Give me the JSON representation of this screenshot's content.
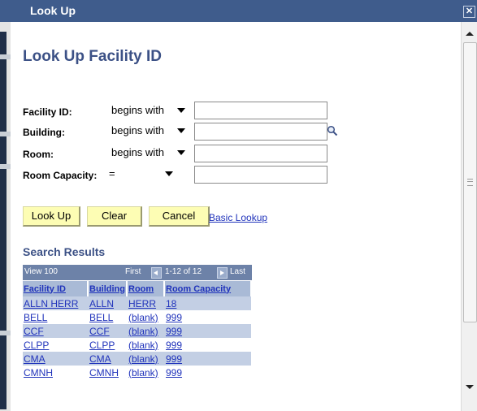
{
  "window": {
    "title": "Look Up",
    "close_glyph": "✕"
  },
  "page_title": "Look Up Facility ID",
  "fields": [
    {
      "label": "Facility ID:",
      "operator": "begins with",
      "value": "",
      "has_lookup": false
    },
    {
      "label": "Building:",
      "operator": "begins with",
      "value": "",
      "has_lookup": true
    },
    {
      "label": "Room:",
      "operator": "begins with",
      "value": "",
      "has_lookup": false
    },
    {
      "label": "Room Capacity:",
      "operator": "=",
      "value": "",
      "has_lookup": false
    }
  ],
  "buttons": {
    "lookup": "Look Up",
    "clear": "Clear",
    "cancel": "Cancel",
    "basic_lookup": "Basic Lookup"
  },
  "results": {
    "heading": "Search Results",
    "view_label": "View 100",
    "first_label": "First",
    "range_label": "1-12 of 12",
    "last_label": "Last",
    "columns": [
      "Facility ID",
      "Building",
      "Room",
      "Room Capacity"
    ],
    "rows": [
      {
        "facility_id": "ALLN HERR",
        "building": "ALLN",
        "room": "HERR",
        "capacity": "18"
      },
      {
        "facility_id": "BELL",
        "building": "BELL",
        "room": "(blank)",
        "capacity": "999"
      },
      {
        "facility_id": "CCF",
        "building": "CCF",
        "room": "(blank)",
        "capacity": "999"
      },
      {
        "facility_id": "CLPP",
        "building": "CLPP",
        "room": "(blank)",
        "capacity": "999"
      },
      {
        "facility_id": "CMA",
        "building": "CMA",
        "room": "(blank)",
        "capacity": "999"
      },
      {
        "facility_id": "CMNH",
        "building": "CMNH",
        "room": "(blank)",
        "capacity": "999"
      }
    ]
  },
  "colors": {
    "titlebar": "#3f5c8c",
    "heading": "#3c5186",
    "button": "#fdfdb4",
    "link": "#2033bb",
    "row_alt": "#c3cfe4",
    "header_row": "#a9bad6"
  },
  "icons": {
    "lookup": "magnifier-icon",
    "close": "close-icon",
    "prev": "prev-arrow-icon",
    "next": "next-arrow-icon"
  }
}
